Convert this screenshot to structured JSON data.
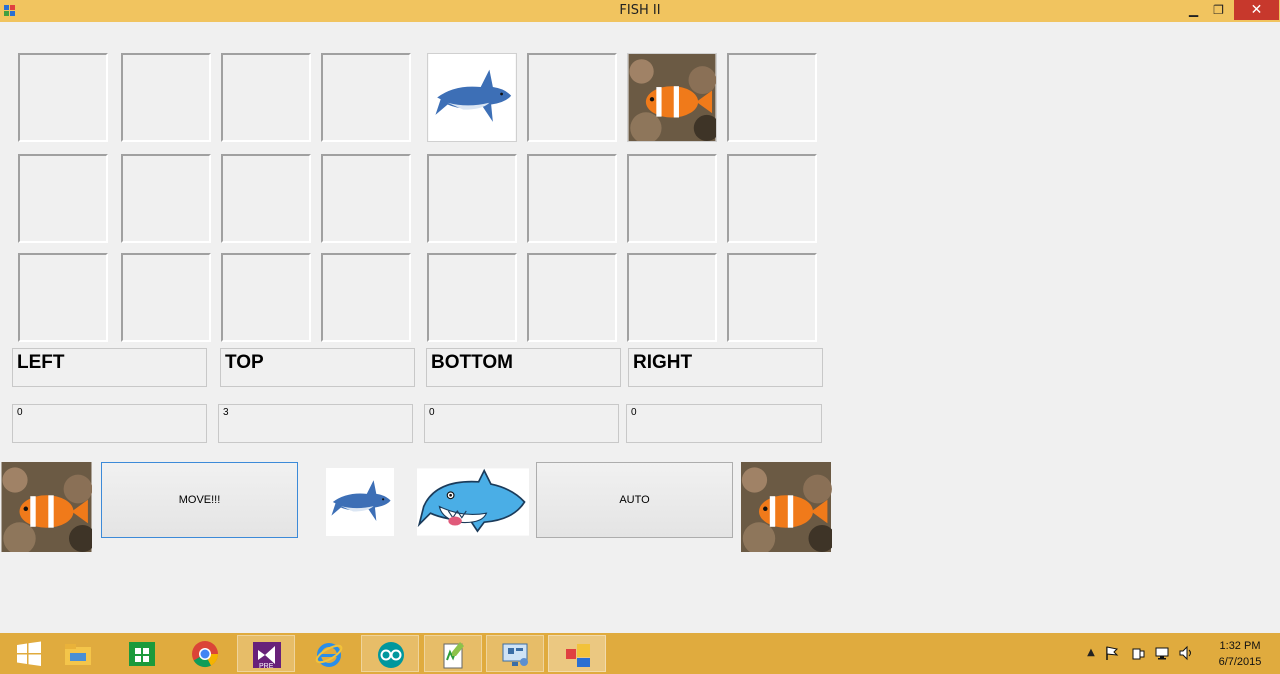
{
  "window": {
    "title": "FISH II",
    "minimize_icon": "minimize-icon",
    "maximize_icon": "restore-icon",
    "close_icon": "close-icon"
  },
  "grid": {
    "rows": 3,
    "cols": 8,
    "cells": [
      [
        "empty",
        "empty",
        "empty",
        "empty",
        "shark",
        "empty",
        "clownfish",
        "empty"
      ],
      [
        "empty",
        "empty",
        "empty",
        "empty",
        "empty",
        "empty",
        "empty",
        "empty"
      ],
      [
        "empty",
        "empty",
        "empty",
        "empty",
        "empty",
        "empty",
        "empty",
        "empty"
      ]
    ]
  },
  "labels": {
    "left": "LEFT",
    "top": "TOP",
    "bottom": "BOTTOM",
    "right": "RIGHT"
  },
  "values": {
    "left": "0",
    "top": "3",
    "bottom": "0",
    "right": "0"
  },
  "buttons": {
    "move": "MOVE!!!",
    "auto": "AUTO"
  },
  "taskbar": {
    "apps": [
      "windows-start-icon",
      "file-explorer-icon",
      "store-icon",
      "chrome-icon",
      "visual-studio-icon",
      "internet-explorer-icon",
      "arduino-icon",
      "notepadpp-icon",
      "remote-desktop-icon",
      "fish-app-icon"
    ],
    "active_app": "fish-app-icon",
    "tray_icons": [
      "show-hidden-icon",
      "flag-icon",
      "power-icon",
      "network-icon",
      "volume-icon"
    ]
  },
  "clock": {
    "time": "1:32 PM",
    "date": "6/7/2015"
  },
  "colors": {
    "titlebar": "#f1c45f",
    "taskbar": "#e0ab3e",
    "close_button": "#c7382c",
    "window_bg": "#f0f0f0"
  }
}
